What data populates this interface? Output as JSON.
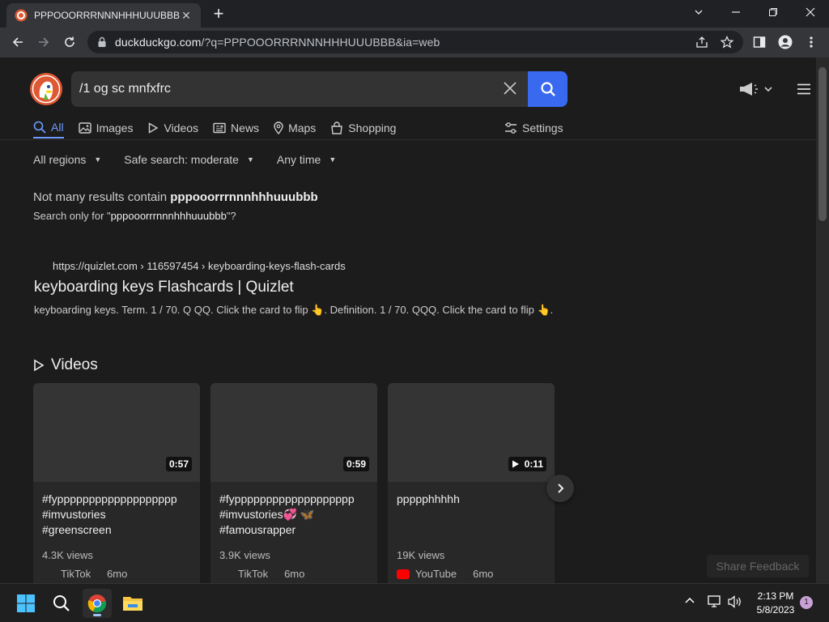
{
  "browser": {
    "tab_title": "PPPOOORRRNNNHHHUUUBBB - ",
    "tab_close": "✕",
    "url_host": "duckduckgo.com",
    "url_path": "/?q=PPPOOORRRNNNHHHUUUBBB&ia=web"
  },
  "search": {
    "query": "/1 og sc mnfxfrc"
  },
  "nav_tabs": [
    {
      "label": "All",
      "icon": "search-icon"
    },
    {
      "label": "Images",
      "icon": "image-icon"
    },
    {
      "label": "Videos",
      "icon": "play-icon"
    },
    {
      "label": "News",
      "icon": "news-icon"
    },
    {
      "label": "Maps",
      "icon": "map-pin-icon"
    },
    {
      "label": "Shopping",
      "icon": "shopping-bag-icon"
    }
  ],
  "settings_label": "Settings",
  "filters": [
    {
      "label": "All regions"
    },
    {
      "label": "Safe search: moderate"
    },
    {
      "label": "Any time"
    }
  ],
  "spelling": {
    "prefix": "Not many results contain",
    "term": "pppooorrrnnnhhhuuubbb",
    "search_only_prefix": "Search only for \"",
    "search_only_term": "pppooorrrnnnhhhuuubbb",
    "search_only_suffix": "\"?"
  },
  "result": {
    "url": "https://quizlet.com › 116597454 › keyboarding-keys-flash-cards",
    "title": "keyboarding keys Flashcards | Quizlet",
    "snippet_a": "keyboarding keys. Term. 1 / 70. Q QQ. Click the card to flip",
    "snippet_b": ". Definition. 1 / 70. QQQ. Click the card to flip",
    "emoji": "👆",
    "snippet_end": "."
  },
  "videos_heading": "Videos",
  "videos": [
    {
      "duration": "0:57",
      "title": "#fyppppppppppppppppppp\n#imvustories\n#greenscreen",
      "views": "4.3K views",
      "source": "TikTok",
      "age": "6mo"
    },
    {
      "duration": "0:59",
      "title": "#fyppppppppppppppppppp\n#imvustories💞 🦋\n#famousrapper",
      "views": "3.9K views",
      "source": "TikTok",
      "age": "6mo"
    },
    {
      "duration": "0:11",
      "title": "ppppphhhhh",
      "views": "19K views",
      "source": "YouTube",
      "age": "6mo"
    }
  ],
  "feedback_label": "Share Feedback",
  "taskbar": {
    "time": "2:13 PM",
    "date": "5/8/2023",
    "notification_count": "1"
  },
  "colors": {
    "accent": "#3969ef",
    "active_tab": "#6e9bff"
  }
}
